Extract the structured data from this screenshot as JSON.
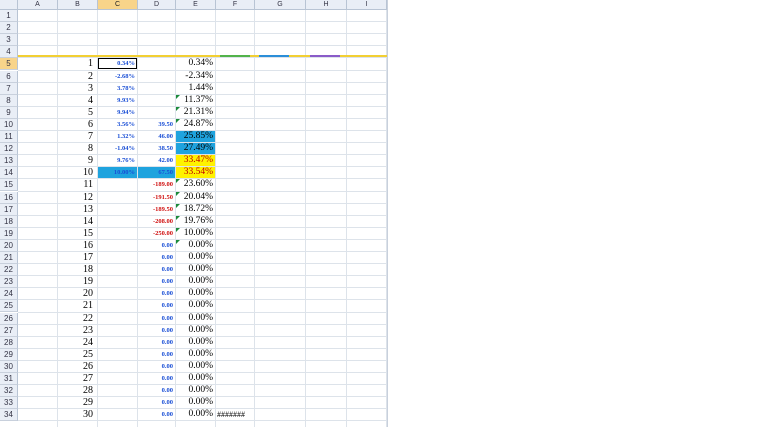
{
  "columns": [
    "A",
    "B",
    "C",
    "D",
    "E",
    "F",
    "G",
    "H",
    "I"
  ],
  "row_numbers": [
    "1",
    "2",
    "3",
    "4",
    "5",
    "6",
    "7",
    "8",
    "9",
    "10",
    "11",
    "12",
    "13",
    "14",
    "15",
    "16",
    "17",
    "18",
    "19",
    "20",
    "21",
    "22",
    "23",
    "24",
    "25",
    "26",
    "27",
    "28",
    "29",
    "30",
    "31",
    "32",
    "33",
    "34"
  ],
  "selected": {
    "column": "C",
    "row": "5",
    "cell": "C5"
  },
  "colors": {
    "highlight_blue": "#1fa3de",
    "highlight_yellow": "#fff200",
    "negative_red": "#d01010",
    "value_blue": "#1a4fd6",
    "header_bar": "#f2cf33"
  },
  "data_rows": [
    {
      "b": "1",
      "c": "0.34%",
      "d": "",
      "e": "0.34%",
      "f": ""
    },
    {
      "b": "2",
      "c": "-2.68%",
      "d": "",
      "e": "-2.34%",
      "f": ""
    },
    {
      "b": "3",
      "c": "3.78%",
      "d": "",
      "e": "1.44%",
      "f": ""
    },
    {
      "b": "4",
      "c": "9.93%",
      "d": "",
      "e": "11.37%",
      "f": ""
    },
    {
      "b": "5",
      "c": "9.94%",
      "d": "",
      "e": "21.31%",
      "f": ""
    },
    {
      "b": "6",
      "c": "3.56%",
      "d": "39.50",
      "e": "24.87%",
      "f": ""
    },
    {
      "b": "7",
      "c": "1.32%",
      "d": "46.00",
      "e": "25.85%",
      "f": ""
    },
    {
      "b": "8",
      "c": "-1.04%",
      "d": "38.50",
      "e": "27.49%",
      "f": ""
    },
    {
      "b": "9",
      "c": "9.76%",
      "d": "42.00",
      "e": "33.47%",
      "f": ""
    },
    {
      "b": "10",
      "c": "10.00%",
      "d": "67.50",
      "e": "33.54%",
      "f": ""
    },
    {
      "b": "11",
      "c": "",
      "d": "-189.00",
      "e": "23.60%",
      "f": ""
    },
    {
      "b": "12",
      "c": "",
      "d": "-191.50",
      "e": "20.04%",
      "f": ""
    },
    {
      "b": "13",
      "c": "",
      "d": "-189.50",
      "e": "18.72%",
      "f": ""
    },
    {
      "b": "14",
      "c": "",
      "d": "-208.00",
      "e": "19.76%",
      "f": ""
    },
    {
      "b": "15",
      "c": "",
      "d": "-250.00",
      "e": "10.00%",
      "f": ""
    },
    {
      "b": "16",
      "c": "",
      "d": "0.00",
      "e": "0.00%",
      "f": ""
    },
    {
      "b": "17",
      "c": "",
      "d": "0.00",
      "e": "0.00%",
      "f": ""
    },
    {
      "b": "18",
      "c": "",
      "d": "0.00",
      "e": "0.00%",
      "f": ""
    },
    {
      "b": "19",
      "c": "",
      "d": "0.00",
      "e": "0.00%",
      "f": ""
    },
    {
      "b": "20",
      "c": "",
      "d": "0.00",
      "e": "0.00%",
      "f": ""
    },
    {
      "b": "21",
      "c": "",
      "d": "0.00",
      "e": "0.00%",
      "f": ""
    },
    {
      "b": "22",
      "c": "",
      "d": "0.00",
      "e": "0.00%",
      "f": ""
    },
    {
      "b": "23",
      "c": "",
      "d": "0.00",
      "e": "0.00%",
      "f": ""
    },
    {
      "b": "24",
      "c": "",
      "d": "0.00",
      "e": "0.00%",
      "f": ""
    },
    {
      "b": "25",
      "c": "",
      "d": "0.00",
      "e": "0.00%",
      "f": ""
    },
    {
      "b": "26",
      "c": "",
      "d": "0.00",
      "e": "0.00%",
      "f": ""
    },
    {
      "b": "27",
      "c": "",
      "d": "0.00",
      "e": "0.00%",
      "f": ""
    },
    {
      "b": "28",
      "c": "",
      "d": "0.00",
      "e": "0.00%",
      "f": ""
    },
    {
      "b": "29",
      "c": "",
      "d": "0.00",
      "e": "0.00%",
      "f": ""
    },
    {
      "b": "30",
      "c": "",
      "d": "0.00",
      "e": "0.00%",
      "f": "#######"
    }
  ]
}
